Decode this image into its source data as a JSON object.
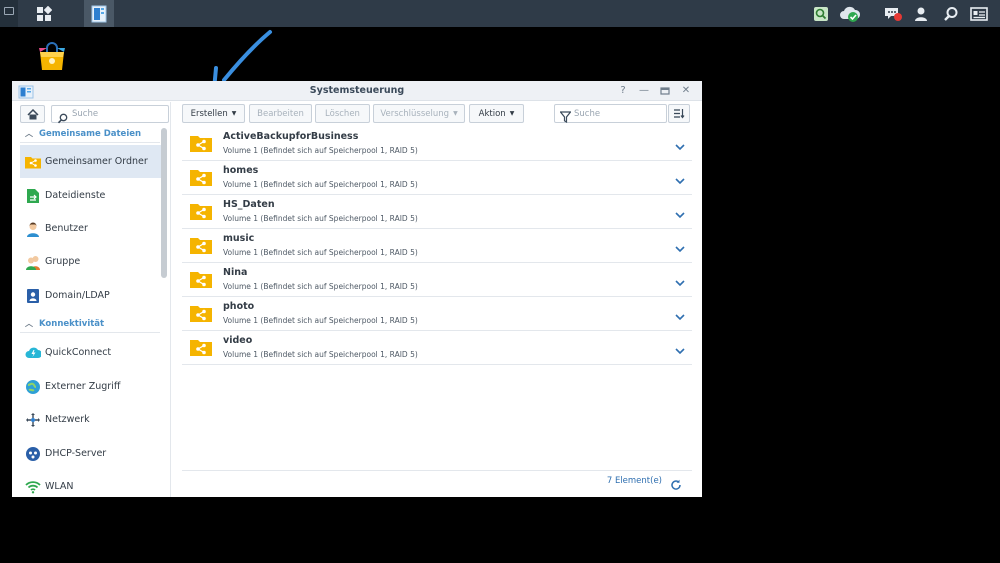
{
  "window": {
    "title": "Systemsteuerung",
    "controls": [
      "help-icon",
      "minimize-icon",
      "maximize-icon",
      "close-icon"
    ]
  },
  "sidebar": {
    "search_placeholder": "Suche",
    "sections": [
      {
        "label": "Gemeinsame Dateien",
        "items": [
          {
            "label": "Gemeinsamer Ordner",
            "icon": "shared-folder-icon",
            "active": true
          },
          {
            "label": "Dateidienste",
            "icon": "file-services-icon"
          },
          {
            "label": "Benutzer",
            "icon": "user-icon"
          },
          {
            "label": "Gruppe",
            "icon": "group-icon"
          },
          {
            "label": "Domain/LDAP",
            "icon": "domain-ldap-icon"
          }
        ]
      },
      {
        "label": "Konnektivität",
        "items": [
          {
            "label": "QuickConnect",
            "icon": "quickconnect-icon"
          },
          {
            "label": "Externer Zugriff",
            "icon": "external-access-icon"
          },
          {
            "label": "Netzwerk",
            "icon": "network-icon"
          },
          {
            "label": "DHCP-Server",
            "icon": "dhcp-server-icon"
          },
          {
            "label": "WLAN",
            "icon": "wifi-icon"
          }
        ]
      }
    ]
  },
  "toolbar": {
    "create": "Erstellen",
    "edit": "Bearbeiten",
    "delete": "Löschen",
    "encryption": "Verschlüsselung",
    "action": "Aktion",
    "search_placeholder": "Suche"
  },
  "folders": [
    {
      "name": "ActiveBackupforBusiness",
      "location": "Volume 1 (Befindet sich auf Speicherpool 1, RAID 5)"
    },
    {
      "name": "homes",
      "location": "Volume 1 (Befindet sich auf Speicherpool 1, RAID 5)"
    },
    {
      "name": "HS_Daten",
      "location": "Volume 1 (Befindet sich auf Speicherpool 1, RAID 5)"
    },
    {
      "name": "music",
      "location": "Volume 1 (Befindet sich auf Speicherpool 1, RAID 5)"
    },
    {
      "name": "Nina",
      "location": "Volume 1 (Befindet sich auf Speicherpool 1, RAID 5)"
    },
    {
      "name": "photo",
      "location": "Volume 1 (Befindet sich auf Speicherpool 1, RAID 5)"
    },
    {
      "name": "video",
      "location": "Volume 1 (Befindet sich auf Speicherpool 1, RAID 5)"
    }
  ],
  "footer": {
    "count": "7 Element(e)"
  },
  "taskbar": {
    "notification_count": "1"
  },
  "colors": {
    "accent": "#2f6fb0",
    "folder": "#f5b400",
    "taskbar": "#2f3b48"
  }
}
